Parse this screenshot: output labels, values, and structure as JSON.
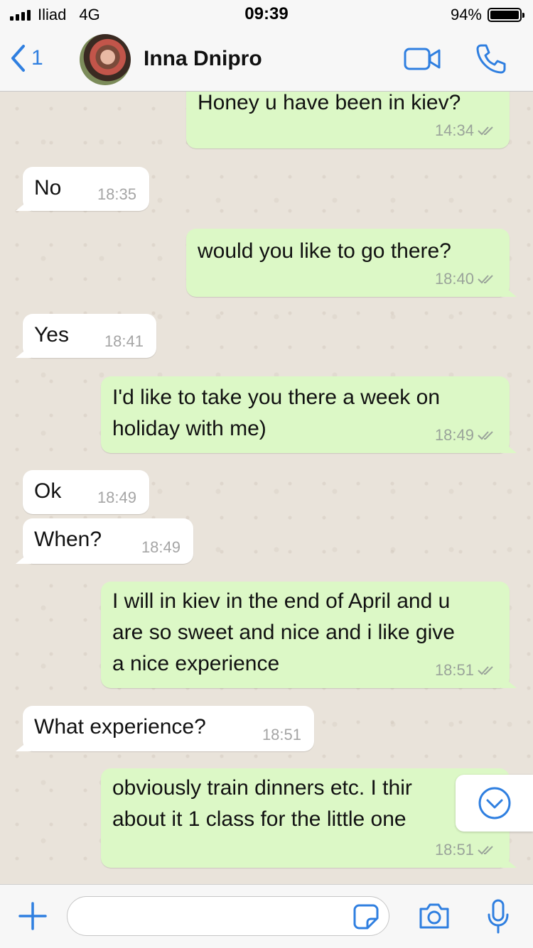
{
  "status_bar": {
    "carrier": "Iliad",
    "network": "4G",
    "time": "09:39",
    "battery": "94%",
    "battery_level": 0.94
  },
  "header": {
    "back_count": "1",
    "contact_name": "Inna Dnipro"
  },
  "messages": [
    {
      "dir": "out",
      "lines": [
        "Honey u have been in kiev?"
      ],
      "time": "14:34"
    },
    {
      "dir": "in",
      "lines": [
        "No"
      ],
      "time": "18:35"
    },
    {
      "dir": "out",
      "lines": [
        "would you like to go there?"
      ],
      "time": "18:40"
    },
    {
      "dir": "in",
      "lines": [
        "Yes"
      ],
      "time": "18:41"
    },
    {
      "dir": "out",
      "lines": [
        "I'd like to take you there a week on",
        "holiday with me)"
      ],
      "time": "18:49"
    },
    {
      "dir": "in",
      "lines": [
        "Ok"
      ],
      "time": "18:49"
    },
    {
      "dir": "in",
      "lines": [
        "When?"
      ],
      "time": "18:49"
    },
    {
      "dir": "out",
      "lines": [
        "I will in kiev in the end of April and u",
        "are so sweet and nice and i like give",
        "a nice experience"
      ],
      "time": "18:51"
    },
    {
      "dir": "in",
      "lines": [
        "What experience?"
      ],
      "time": "18:51"
    },
    {
      "dir": "out",
      "lines": [
        "obviously train dinners etc. I thir",
        "about it 1 class for the little one"
      ],
      "time": "18:51"
    }
  ],
  "input": {
    "value": "",
    "placeholder": ""
  },
  "icons": {
    "back": "chevron-left-icon",
    "video": "video-camera-icon",
    "phone": "phone-icon",
    "plus": "plus-icon",
    "sticker": "sticker-icon",
    "camera": "camera-icon",
    "mic": "microphone-icon",
    "scroll": "chevron-down-circle-icon"
  },
  "colors": {
    "accent": "#2f7fe0",
    "outgoing_bubble": "#dcf8c6",
    "incoming_bubble": "#ffffff",
    "chat_background": "#e9e3da"
  }
}
